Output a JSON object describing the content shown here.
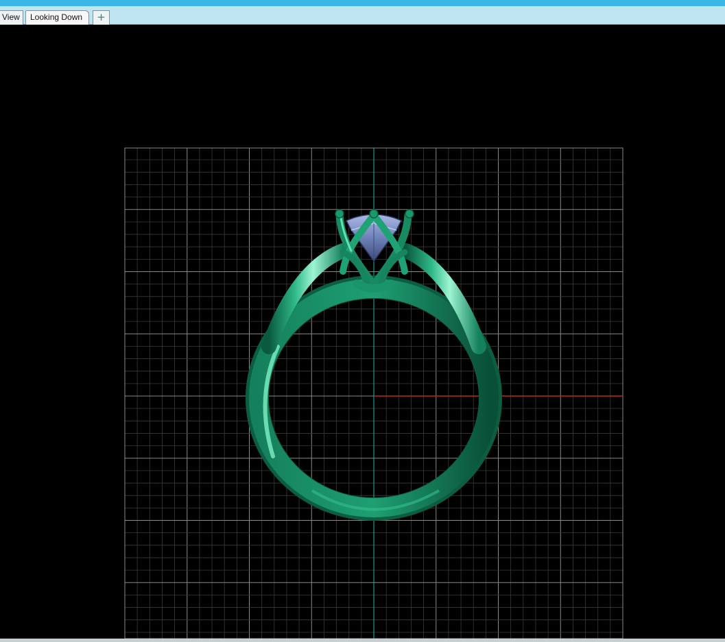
{
  "tabs": {
    "view_label": "View",
    "active_label": "Looking Down",
    "add_symbol": "+"
  },
  "viewport": {
    "background": "#000000",
    "grid_minor_color": "#3a3a3a",
    "grid_major_color": "#8a8a8a",
    "axis_vertical_color": "#1fb5a8",
    "axis_horizontal_color": "#c0281c",
    "model": {
      "object": "ring",
      "metal_color": "#1c8f68",
      "stone_color": "#7f93c8"
    }
  },
  "colors": {
    "title_strip": "#3cb6e6",
    "tabbar": "#bfe4f2"
  }
}
